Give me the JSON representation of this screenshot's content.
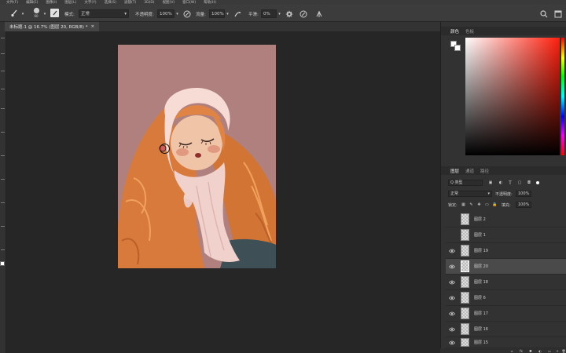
{
  "menu": [
    "文件(F)",
    "编辑(E)",
    "图像(I)",
    "图层(L)",
    "文字(Y)",
    "选择(S)",
    "滤镜(T)",
    "3D(D)",
    "视图(V)",
    "窗口(W)",
    "帮助(H)"
  ],
  "options": {
    "brush_size": "60",
    "mode_label": "模式:",
    "mode_value": "正常",
    "opacity_label": "不透明度:",
    "opacity_value": "100%",
    "flow_label": "流量:",
    "flow_value": "100%",
    "smooth_label": "平滑:",
    "smooth_value": "0%"
  },
  "document_tab": {
    "title": "未标题-1 @ 16.7% (图层 20, RGB/8) *",
    "close": "×"
  },
  "color_panel": {
    "tabs": [
      "颜色",
      "色板"
    ],
    "foreground": "#ffffff",
    "background": "#ffffff"
  },
  "layers_panel": {
    "tabs": [
      "图层",
      "通道",
      "路径"
    ],
    "filter_label": "Q 类型",
    "blend_mode": "正常",
    "opacity_label": "不透明度:",
    "opacity_value": "100%",
    "lock_label": "锁定:",
    "fill_label": "填充:",
    "fill_value": "100%",
    "layers": [
      {
        "name": "图层 2",
        "visible": false
      },
      {
        "name": "图层 1",
        "visible": false
      },
      {
        "name": "图层 19",
        "visible": true
      },
      {
        "name": "图层 20",
        "visible": true,
        "selected": true
      },
      {
        "name": "图层 18",
        "visible": true
      },
      {
        "name": "图层 6",
        "visible": true
      },
      {
        "name": "图层 17",
        "visible": true
      },
      {
        "name": "图层 16",
        "visible": true
      },
      {
        "name": "图层 15",
        "visible": true
      }
    ]
  }
}
